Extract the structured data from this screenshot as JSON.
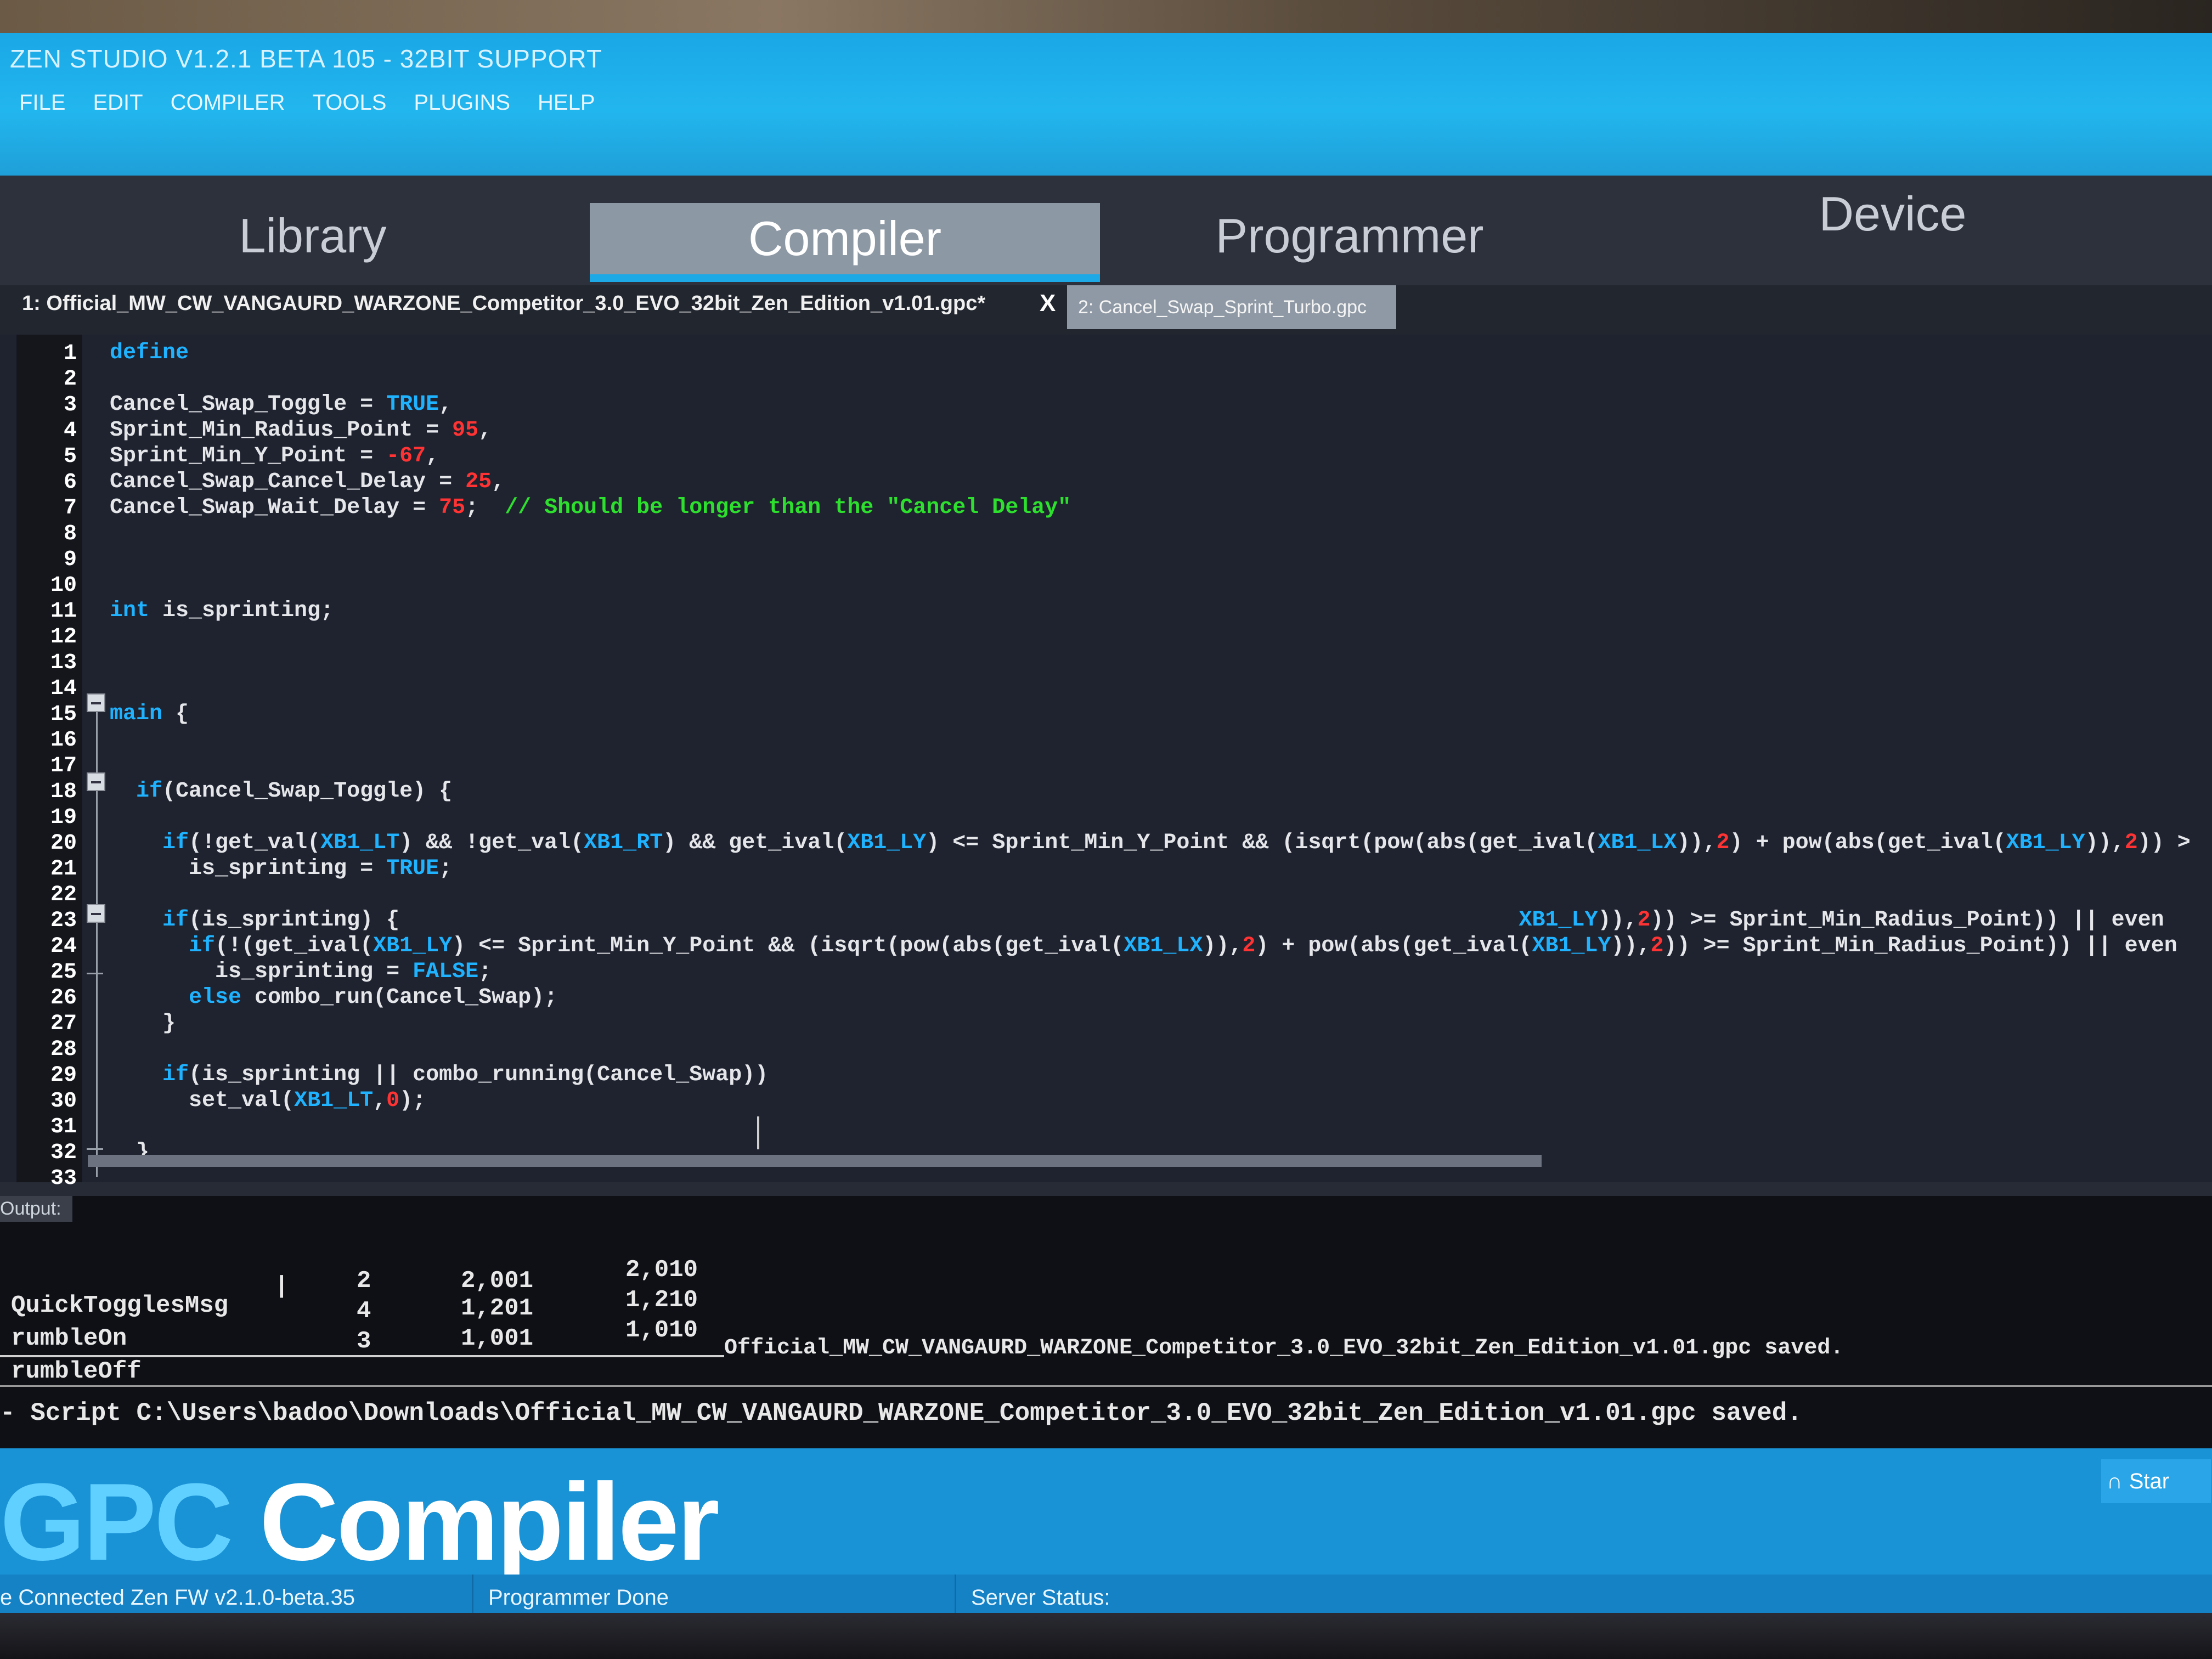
{
  "window": {
    "title": "ZEN STUDIO V1.2.1 BETA 105 - 32BIT SUPPORT",
    "menu": [
      "FILE",
      "EDIT",
      "COMPILER",
      "TOOLS",
      "PLUGINS",
      "HELP"
    ]
  },
  "main_tabs": {
    "library": "Library",
    "compiler": "Compiler",
    "programmer": "Programmer",
    "device": "Device",
    "active": "Compiler"
  },
  "file_tabs": {
    "tab1": "1: Official_MW_CW_VANGAURD_WARZONE_Competitor_3.0_EVO_32bit_Zen_Edition_v1.01.gpc*",
    "tab1_close": "X",
    "tab2": "2: Cancel_Swap_Sprint_Turbo.gpc"
  },
  "editor": {
    "line_numbers": [
      "1",
      "2",
      "3",
      "4",
      "5",
      "6",
      "7",
      "8",
      "9",
      "10",
      "11",
      "12",
      "13",
      "14",
      "15",
      "16",
      "17",
      "18",
      "19",
      "20",
      "21",
      "22",
      "23",
      "24",
      "25",
      "26",
      "27",
      "28",
      "29",
      "30",
      "31",
      "32",
      "33"
    ],
    "lines": [
      {
        "n": 1,
        "segs": [
          {
            "t": "define",
            "c": "kw"
          }
        ]
      },
      {
        "n": 3,
        "segs": [
          {
            "t": "Cancel_Swap_Toggle = ",
            "c": ""
          },
          {
            "t": "TRUE",
            "c": "const"
          },
          {
            "t": ",",
            "c": ""
          }
        ]
      },
      {
        "n": 4,
        "segs": [
          {
            "t": "Sprint_Min_Radius_Point = ",
            "c": ""
          },
          {
            "t": "95",
            "c": "num"
          },
          {
            "t": ",",
            "c": ""
          }
        ]
      },
      {
        "n": 5,
        "segs": [
          {
            "t": "Sprint_Min_Y_Point = ",
            "c": ""
          },
          {
            "t": "-67",
            "c": "num"
          },
          {
            "t": ",",
            "c": ""
          }
        ]
      },
      {
        "n": 6,
        "segs": [
          {
            "t": "Cancel_Swap_Cancel_Delay = ",
            "c": ""
          },
          {
            "t": "25",
            "c": "num"
          },
          {
            "t": ",",
            "c": ""
          }
        ]
      },
      {
        "n": 7,
        "segs": [
          {
            "t": "Cancel_Swap_Wait_Delay = ",
            "c": ""
          },
          {
            "t": "75",
            "c": "num"
          },
          {
            "t": ";  ",
            "c": ""
          },
          {
            "t": "// Should be longer than the \"Cancel Delay\"",
            "c": "cm"
          }
        ]
      },
      {
        "n": 11,
        "segs": [
          {
            "t": "int",
            "c": "kw"
          },
          {
            "t": " is_sprinting;",
            "c": ""
          }
        ]
      },
      {
        "n": 15,
        "segs": [
          {
            "t": "main",
            "c": "kw"
          },
          {
            "t": " {",
            "c": ""
          }
        ]
      },
      {
        "n": 18,
        "segs": [
          {
            "t": "  ",
            "c": ""
          },
          {
            "t": "if",
            "c": "kw"
          },
          {
            "t": "(Cancel_Swap_Toggle) {",
            "c": ""
          }
        ]
      },
      {
        "n": 20,
        "segs": [
          {
            "t": "    ",
            "c": ""
          },
          {
            "t": "if",
            "c": "kw"
          },
          {
            "t": "(!get_val(",
            "c": ""
          },
          {
            "t": "XB1_LT",
            "c": "const"
          },
          {
            "t": ") && !get_val(",
            "c": ""
          },
          {
            "t": "XB1_RT",
            "c": "const"
          },
          {
            "t": ") && get_ival(",
            "c": ""
          },
          {
            "t": "XB1_LY",
            "c": "const"
          },
          {
            "t": ") <= Sprint_Min_Y_Point && (isqrt(pow(abs(get_ival(",
            "c": ""
          },
          {
            "t": "XB1_LX",
            "c": "const"
          },
          {
            "t": ")),",
            "c": ""
          },
          {
            "t": "2",
            "c": "num"
          },
          {
            "t": ") + pow(abs(get_ival(",
            "c": ""
          },
          {
            "t": "XB1_LY",
            "c": "const"
          },
          {
            "t": ")),",
            "c": ""
          },
          {
            "t": "2",
            "c": "num"
          },
          {
            "t": ")) >",
            "c": ""
          }
        ]
      },
      {
        "n": 21,
        "segs": [
          {
            "t": "      is_sprinting = ",
            "c": ""
          },
          {
            "t": "TRUE",
            "c": "const"
          },
          {
            "t": ";",
            "c": ""
          }
        ]
      },
      {
        "n": 23,
        "segs": [
          {
            "t": "    ",
            "c": ""
          },
          {
            "t": "if",
            "c": "kw"
          },
          {
            "t": "(is_sprinting) {",
            "c": ""
          },
          {
            "t": "                                                                                     ",
            "c": ""
          },
          {
            "t": "XB1_LY",
            "c": "const"
          },
          {
            "t": ")),",
            "c": ""
          },
          {
            "t": "2",
            "c": "num"
          },
          {
            "t": ")) >= Sprint_Min_Radius_Point)) || even",
            "c": ""
          }
        ]
      },
      {
        "n": 24,
        "segs": [
          {
            "t": "      ",
            "c": ""
          },
          {
            "t": "if",
            "c": "kw"
          },
          {
            "t": "(!(get_ival(",
            "c": ""
          },
          {
            "t": "XB1_LY",
            "c": "const"
          },
          {
            "t": ") <= Sprint_Min_Y_Point && (isqrt(pow(abs(get_ival(",
            "c": ""
          },
          {
            "t": "XB1_LX",
            "c": "const"
          },
          {
            "t": ")),",
            "c": ""
          },
          {
            "t": "2",
            "c": "num"
          },
          {
            "t": ") + pow(abs(get_ival(",
            "c": ""
          },
          {
            "t": "XB1_LY",
            "c": "const"
          },
          {
            "t": ")),",
            "c": ""
          },
          {
            "t": "2",
            "c": "num"
          },
          {
            "t": ")) >= Sprint_Min_Radius_Point)) || even",
            "c": ""
          }
        ]
      },
      {
        "n": 25,
        "segs": [
          {
            "t": "        is_sprinting = ",
            "c": ""
          },
          {
            "t": "FALSE",
            "c": "const"
          },
          {
            "t": ";",
            "c": ""
          }
        ]
      },
      {
        "n": 26,
        "segs": [
          {
            "t": "      ",
            "c": ""
          },
          {
            "t": "else",
            "c": "kw"
          },
          {
            "t": " combo_run(Cancel_Swap);",
            "c": ""
          }
        ]
      },
      {
        "n": 27,
        "segs": [
          {
            "t": "    }",
            "c": ""
          }
        ]
      },
      {
        "n": 29,
        "segs": [
          {
            "t": "    ",
            "c": ""
          },
          {
            "t": "if",
            "c": "kw"
          },
          {
            "t": "(is_sprinting || combo_running(Cancel_Swap))",
            "c": ""
          }
        ]
      },
      {
        "n": 30,
        "segs": [
          {
            "t": "      set_val(",
            "c": ""
          },
          {
            "t": "XB1_LT",
            "c": "const"
          },
          {
            "t": ",",
            "c": ""
          },
          {
            "t": "0",
            "c": "num"
          },
          {
            "t": ");",
            "c": ""
          }
        ]
      },
      {
        "n": 32,
        "segs": [
          {
            "t": "  }",
            "c": ""
          }
        ]
      }
    ]
  },
  "output": {
    "label": "Output:",
    "rows": [
      {
        "name": "QuickTogglesMsg",
        "a": "2",
        "b": "2,001",
        "c": "2,010"
      },
      {
        "name": "rumbleOn",
        "a": "4",
        "b": "1,201",
        "c": "1,210"
      },
      {
        "name": "rumbleOff",
        "a": "3",
        "b": "1,001",
        "c": "1,010"
      }
    ],
    "saved_msg": "Official_MW_CW_VANGAURD_WARZONE_Competitor_3.0_EVO_32bit_Zen_Edition_v1.01.gpc saved.",
    "script_path": "- Script C:\\Users\\badoo\\Downloads\\Official_MW_CW_VANGAURD_WARZONE_Competitor_3.0_EVO_32bit_Zen_Edition_v1.01.gpc saved."
  },
  "bottom": {
    "logo_gpc": "GPC",
    "logo_compiler": " Compiler",
    "start_label": "Star",
    "status_connected": "e Connected Zen FW v2.1.0-beta.35",
    "status_programmer": "Programmer Done",
    "status_server": "Server Status:"
  },
  "colors": {
    "accent": "#1fb3ff",
    "keyword": "#1fb3ff",
    "number": "#ff3333",
    "comment": "#2de02d",
    "title_bar": "#22b6ee"
  }
}
